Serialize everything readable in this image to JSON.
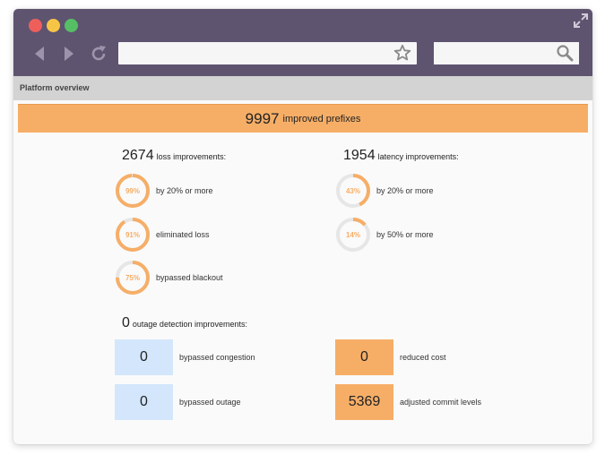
{
  "window": {
    "url_value": "",
    "search_value": ""
  },
  "breadcrumb": "Platform overview",
  "banner": {
    "value": "9997",
    "label": "improved prefixes"
  },
  "loss": {
    "value": "2674",
    "label": "loss improvements:",
    "items": [
      {
        "pct": 99,
        "pct_text": "99%",
        "label": "by 20% or more"
      },
      {
        "pct": 91,
        "pct_text": "91%",
        "label": "eliminated loss"
      },
      {
        "pct": 75,
        "pct_text": "75%",
        "label": "bypassed blackout"
      }
    ]
  },
  "latency": {
    "value": "1954",
    "label": "latency improvements:",
    "items": [
      {
        "pct": 43,
        "pct_text": "43%",
        "label": "by 20% or more"
      },
      {
        "pct": 14,
        "pct_text": "14%",
        "label": "by 50% or more"
      }
    ]
  },
  "outage": {
    "value": "0",
    "label": "outage detection improvements:",
    "tiles": [
      {
        "value": "0",
        "label": "bypassed congestion"
      },
      {
        "value": "0",
        "label": "bypassed outage"
      }
    ]
  },
  "cost": {
    "tiles": [
      {
        "value": "0",
        "label": "reduced cost"
      },
      {
        "value": "5369",
        "label": "adjusted commit levels"
      }
    ]
  },
  "colors": {
    "accent": "#f6ae67",
    "ring_track": "#e6e6e6",
    "tile_blue": "#d3e6fb",
    "titlebar": "#5e5470"
  },
  "icons": [
    "back-arrow-icon",
    "forward-arrow-icon",
    "reload-icon",
    "star-icon",
    "search-icon",
    "expand-icon"
  ]
}
